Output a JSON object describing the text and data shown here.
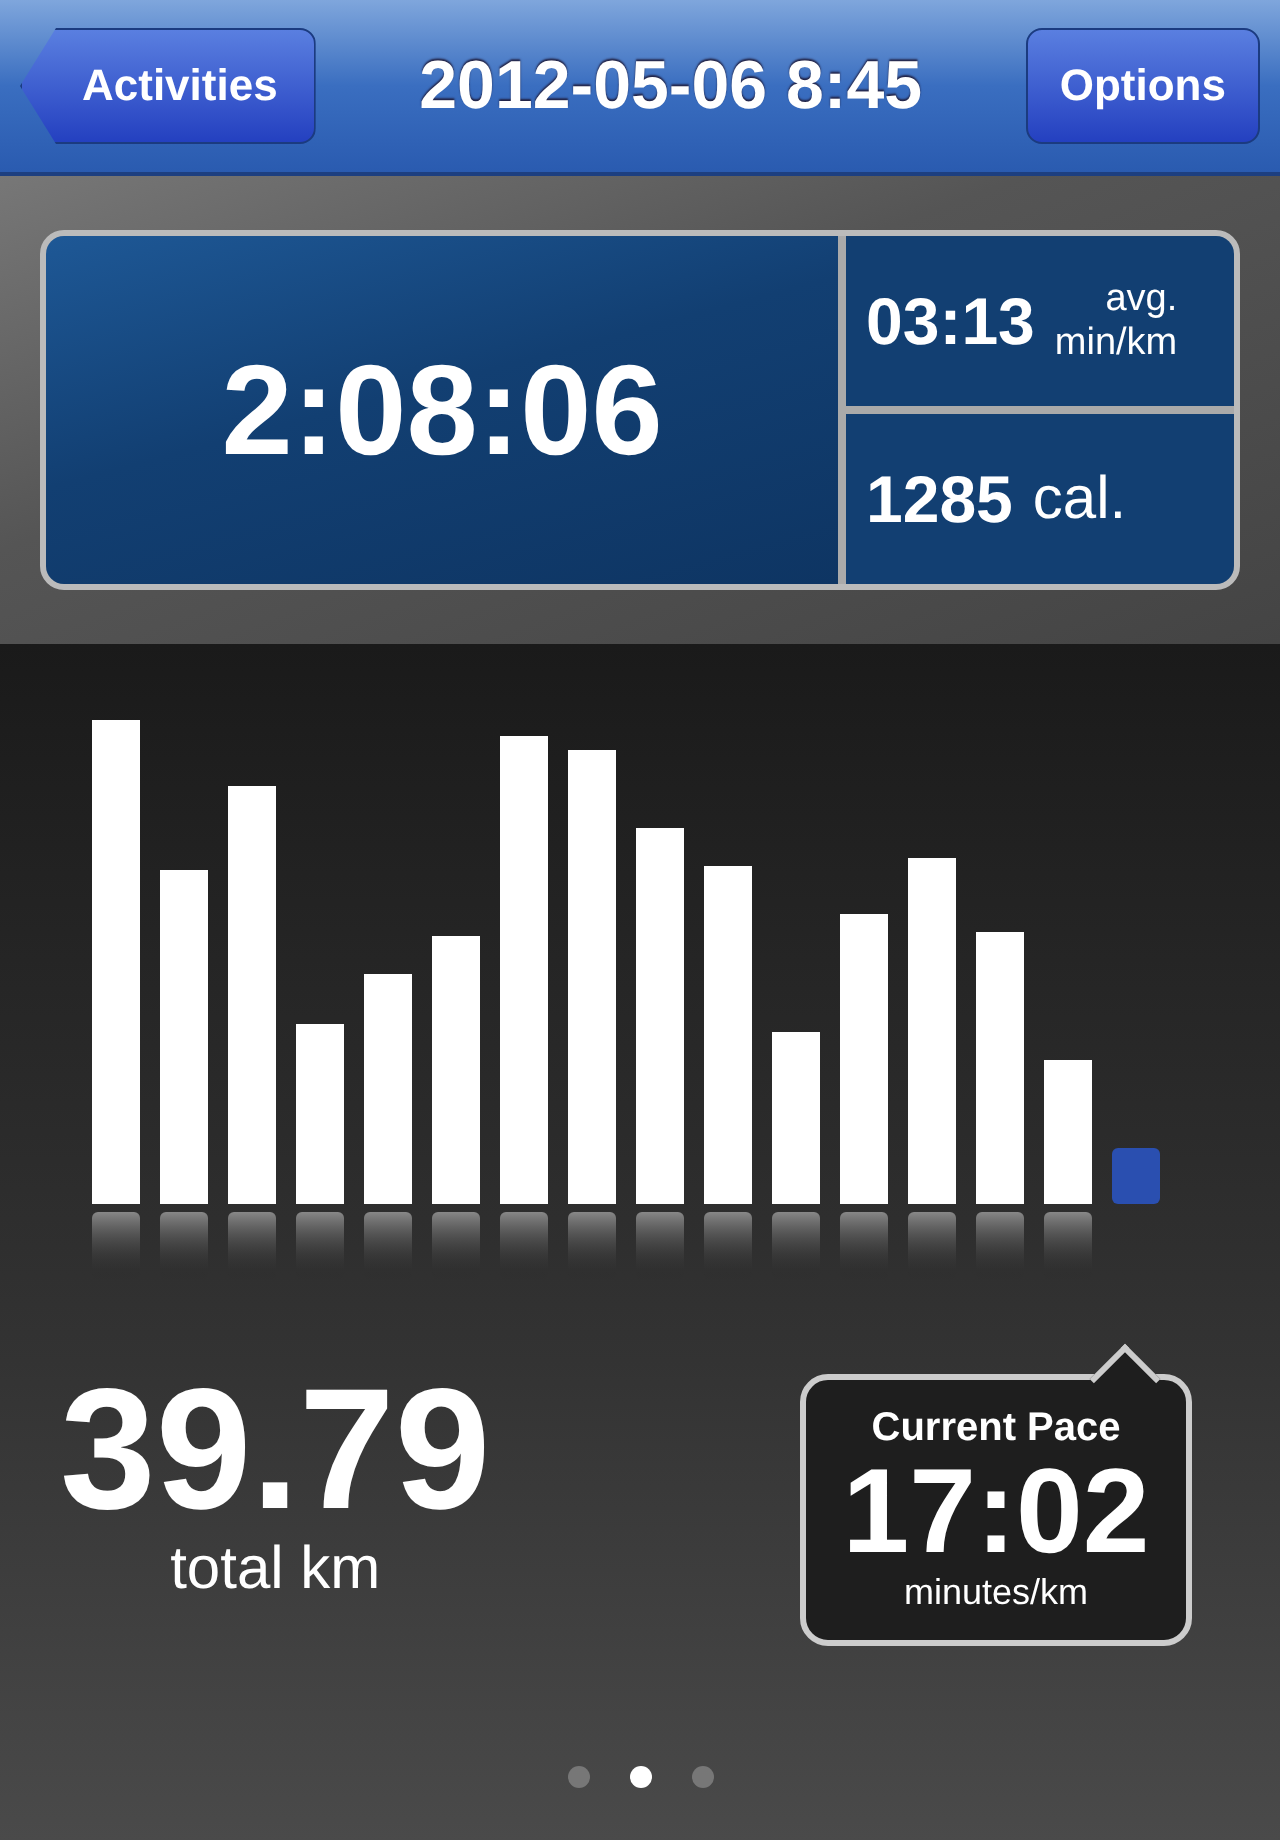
{
  "nav": {
    "back": "Activities",
    "title": "2012-05-06 8:45",
    "options": "Options"
  },
  "stats": {
    "duration": "2:08:06",
    "pace": "03:13",
    "pace_unit_1": "avg.",
    "pace_unit_2": "min/km",
    "calories": "1285",
    "calories_unit": "cal."
  },
  "distance": {
    "value": "39.79",
    "unit": "total km"
  },
  "current_pace": {
    "label": "Current Pace",
    "value": "17:02",
    "unit": "minutes/km"
  },
  "pages": [
    {
      "selected": false
    },
    {
      "selected": true
    },
    {
      "selected": false
    }
  ]
}
